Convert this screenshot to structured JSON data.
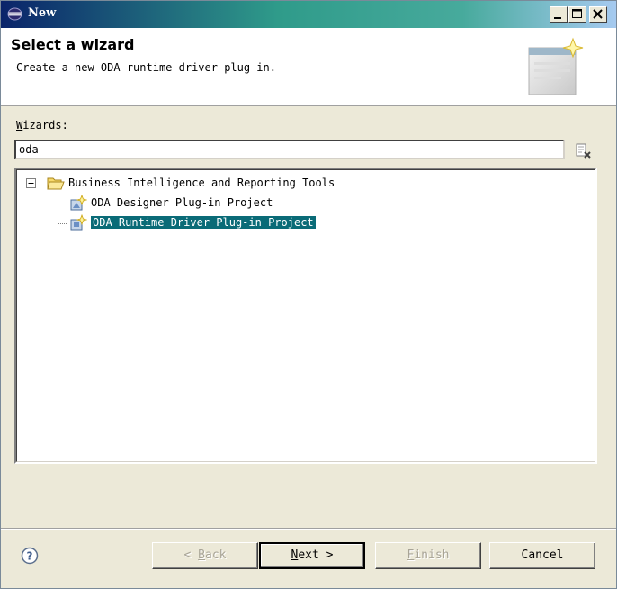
{
  "window": {
    "title": "New"
  },
  "banner": {
    "title": "Select a wizard",
    "description": "Create a new ODA runtime driver plug-in."
  },
  "wizards": {
    "label_mnemonic": "W",
    "label_rest": "izards:",
    "filter_value": "oda"
  },
  "tree": {
    "category": {
      "label": "Business Intelligence and Reporting Tools",
      "expander": "−"
    },
    "items": [
      {
        "label": "ODA Designer Plug-in Project",
        "selected": false
      },
      {
        "label": "ODA Runtime Driver Plug-in Project",
        "selected": true
      }
    ]
  },
  "buttons": {
    "back": {
      "prefix": "< ",
      "mnemonic": "B",
      "rest": "ack",
      "enabled": false
    },
    "next": {
      "mnemonic": "N",
      "rest": "ext >",
      "enabled": true
    },
    "finish": {
      "mnemonic": "F",
      "rest": "inish",
      "enabled": false
    },
    "cancel": {
      "label": "Cancel",
      "enabled": true
    }
  },
  "icons": {
    "title": "eclipse-icon",
    "minimize": "minimize-icon",
    "maximize": "maximize-icon",
    "close": "close-icon",
    "banner": "wizard-banner-icon",
    "clear": "clear-filter-icon",
    "folder": "folder-open-icon",
    "project": "plugin-project-icon",
    "help": "help-icon"
  },
  "colors": {
    "selection": "#0a6b77",
    "titlebar_start": "#0a246a",
    "titlebar_mid": "#2f9b8a"
  }
}
